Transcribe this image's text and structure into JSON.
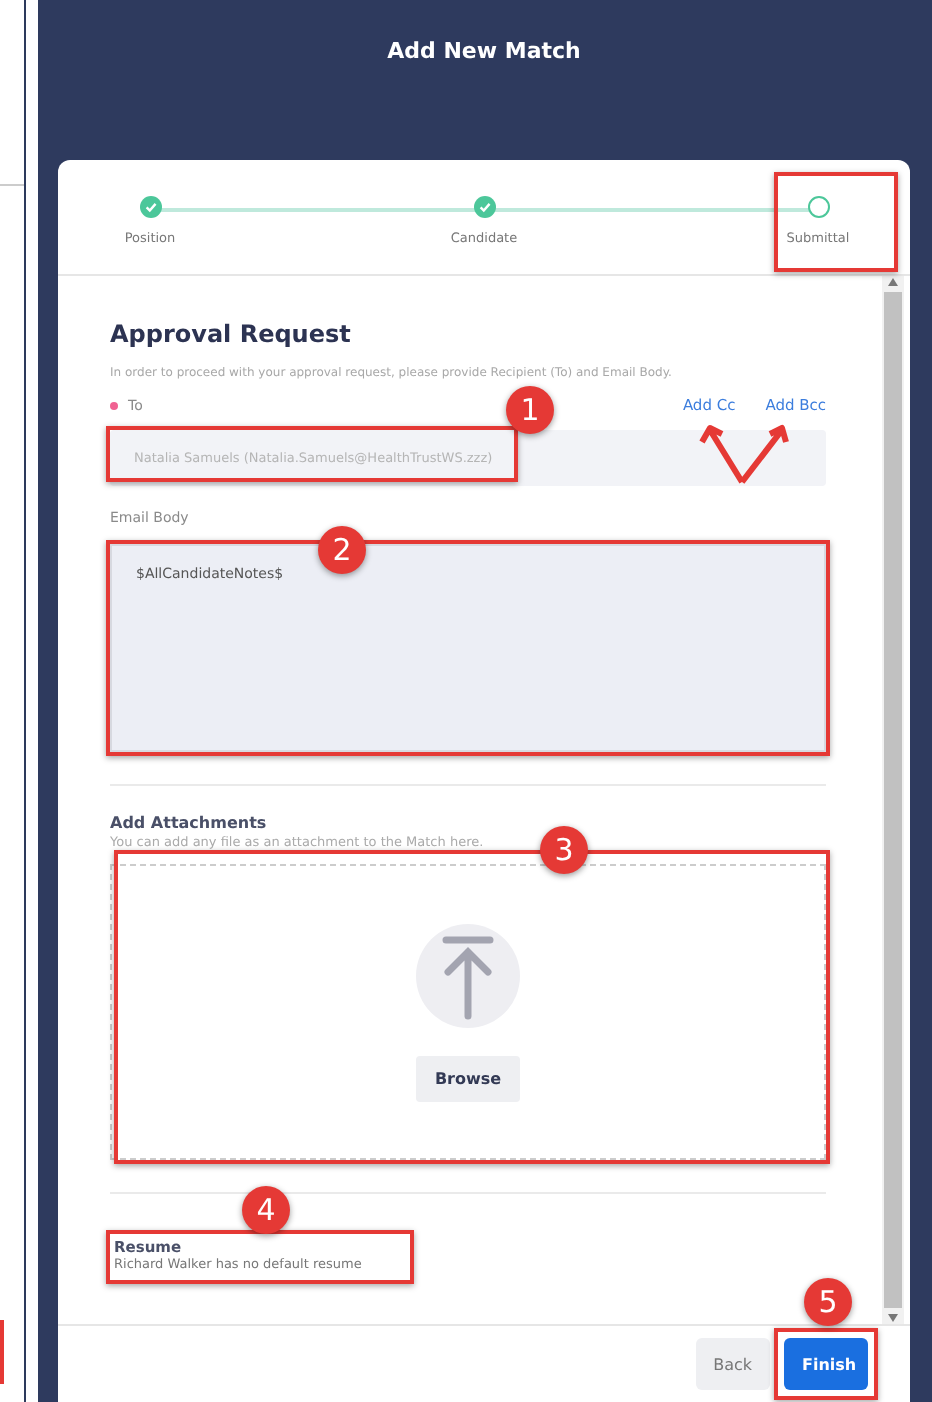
{
  "modal": {
    "title": "Add New Match"
  },
  "steps": [
    {
      "label": "Position",
      "done": true
    },
    {
      "label": "Candidate",
      "done": true
    },
    {
      "label": "Submittal",
      "done": false
    }
  ],
  "approval": {
    "heading": "Approval Request",
    "hint": "In order to proceed with your approval request, please provide Recipient (To) and Email Body.",
    "to_label": "To",
    "required": true,
    "links": [
      "Add Cc",
      "Add Bcc"
    ],
    "to_value": "Natalia Samuels (Natalia.Samuels@HealthTrustWS.zzz)",
    "body_label": "Email Body",
    "body_value": "$AllCandidateNotes$"
  },
  "attachments": {
    "heading": "Add Attachments",
    "hint": "You can add any file as an attachment to the Match here.",
    "button": "Browse"
  },
  "resume": {
    "heading": "Resume",
    "text": "Richard Walker has no default resume"
  },
  "footer": {
    "buttons": [
      {
        "label": "Back",
        "kind": "secondary"
      },
      {
        "label": "Finish",
        "kind": "primary"
      }
    ]
  },
  "callouts": [
    "1",
    "2",
    "3",
    "4",
    "5"
  ]
}
